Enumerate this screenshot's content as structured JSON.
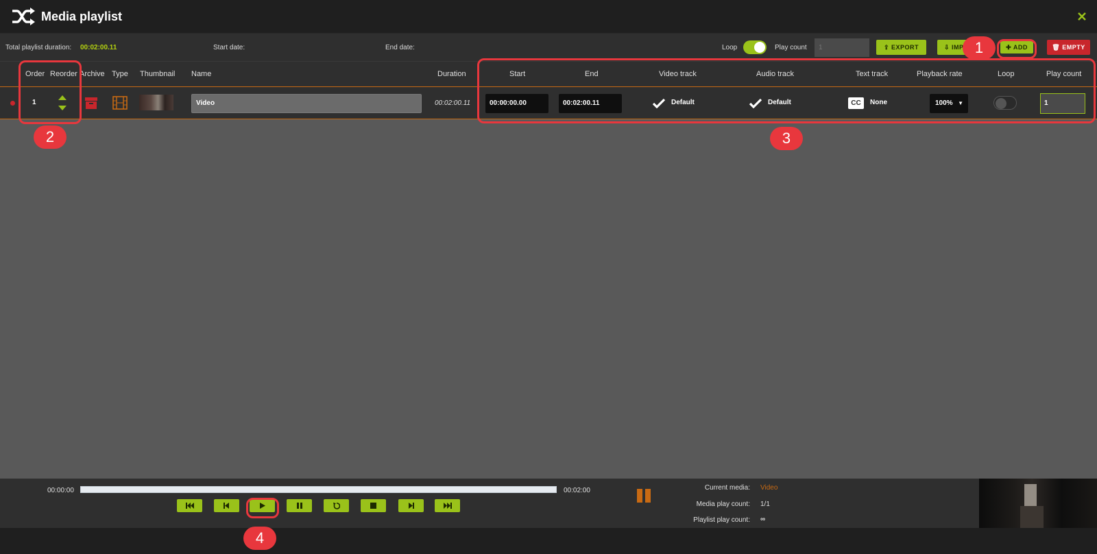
{
  "window": {
    "title": "Media playlist",
    "logo_icon": "shuffle-icon",
    "close_icon": "close-icon"
  },
  "toolbar": {
    "total_duration_label": "Total playlist duration:",
    "total_duration_value": "00:02:00.11",
    "start_date_label": "Start date:",
    "end_date_label": "End date:",
    "loop_label": "Loop",
    "loop_on": true,
    "play_count_label": "Play count",
    "play_count_placeholder": "1",
    "export_label": "EXPORT",
    "import_label": "IMP",
    "add_label": "ADD",
    "empty_label": "EMPTY"
  },
  "columns": {
    "order": "Order",
    "reorder": "Reorder",
    "archive": "Archive",
    "type": "Type",
    "thumbnail": "Thumbnail",
    "name": "Name",
    "duration": "Duration",
    "start": "Start",
    "end": "End",
    "video_track": "Video track",
    "audio_track": "Audio track",
    "text_track": "Text track",
    "playback_rate": "Playback rate",
    "loop": "Loop",
    "play_count": "Play count"
  },
  "row": {
    "order": "1",
    "name": "Video",
    "duration": "00:02:00.11",
    "start": "00:00:00.00",
    "end": "00:02:00.11",
    "video_track": "Default",
    "audio_track": "Default",
    "text_track_badge": "CC",
    "text_track": "None",
    "playback_rate": "100%",
    "loop_on": false,
    "play_count": "1"
  },
  "annotations": [
    "1",
    "2",
    "3",
    "4"
  ],
  "player": {
    "time_start": "00:00:00",
    "time_end": "00:02:00",
    "progress": 0,
    "current_media_label": "Current media:",
    "current_media_value": "Video",
    "media_play_count_label": "Media play count:",
    "media_play_count_value": "1/1",
    "playlist_play_count_label": "Playlist play count:",
    "playlist_play_count_value": "∞"
  },
  "colors": {
    "accent": "#9ac21a",
    "danger": "#c8262c",
    "orange": "#c86a13",
    "annotation": "#e8373d"
  }
}
